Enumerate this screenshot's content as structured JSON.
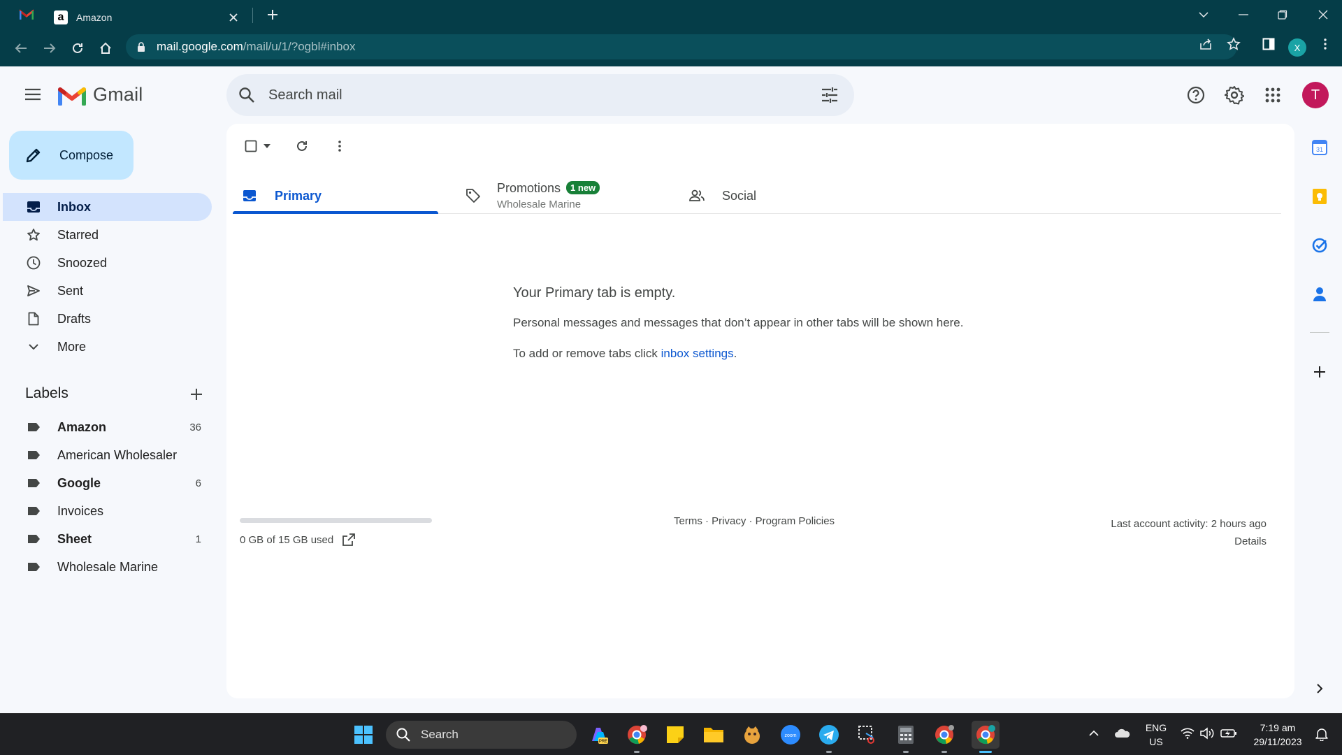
{
  "browser": {
    "tab_title": "Amazon",
    "url_host": "mail.google.com",
    "url_path": "/mail/u/1/?ogbl#inbox",
    "profile_initial": "X"
  },
  "gmail": {
    "logo_text": "Gmail",
    "search_placeholder": "Search mail",
    "avatar_initial": "T",
    "compose_label": "Compose",
    "nav": [
      {
        "label": "Inbox",
        "icon": "inbox-icon",
        "active": true
      },
      {
        "label": "Starred",
        "icon": "star-icon"
      },
      {
        "label": "Snoozed",
        "icon": "clock-icon"
      },
      {
        "label": "Sent",
        "icon": "send-icon"
      },
      {
        "label": "Drafts",
        "icon": "draft-icon"
      },
      {
        "label": "More",
        "icon": "chevron-down-icon"
      }
    ],
    "labels_title": "Labels",
    "labels": [
      {
        "label": "Amazon",
        "count": "36",
        "bold": true
      },
      {
        "label": "American Wholesaler",
        "count": ""
      },
      {
        "label": "Google",
        "count": "6",
        "bold": true
      },
      {
        "label": "Invoices",
        "count": ""
      },
      {
        "label": "Sheet",
        "count": "1",
        "bold": true
      },
      {
        "label": "Wholesale Marine",
        "count": ""
      }
    ],
    "tabs": {
      "primary": "Primary",
      "promotions": "Promotions",
      "promotions_badge": "1 new",
      "promotions_sub": "Wholesale Marine",
      "social": "Social"
    },
    "empty": {
      "title": "Your Primary tab is empty.",
      "line1": "Personal messages and messages that don’t appear in other tabs will be shown here.",
      "line2_prefix": "To add or remove tabs click ",
      "line2_link": "inbox settings",
      "line2_suffix": "."
    },
    "footer": {
      "storage": "0 GB of 15 GB used",
      "storage_fraction": 0.0,
      "links": "Terms · Privacy · Program Policies",
      "activity": "Last account activity: 2 hours ago",
      "details": "Details"
    }
  },
  "taskbar": {
    "search_label": "Search",
    "lang_line1": "ENG",
    "lang_line2": "US",
    "time": "7:19 am",
    "date": "29/11/2023"
  },
  "colors": {
    "chrome_frame": "#053d48",
    "compose_bg": "#c2e7ff",
    "active_nav": "#d3e3fd",
    "accent_blue": "#0b57d0",
    "badge_green": "#188038",
    "avatar": "#c2185b"
  }
}
